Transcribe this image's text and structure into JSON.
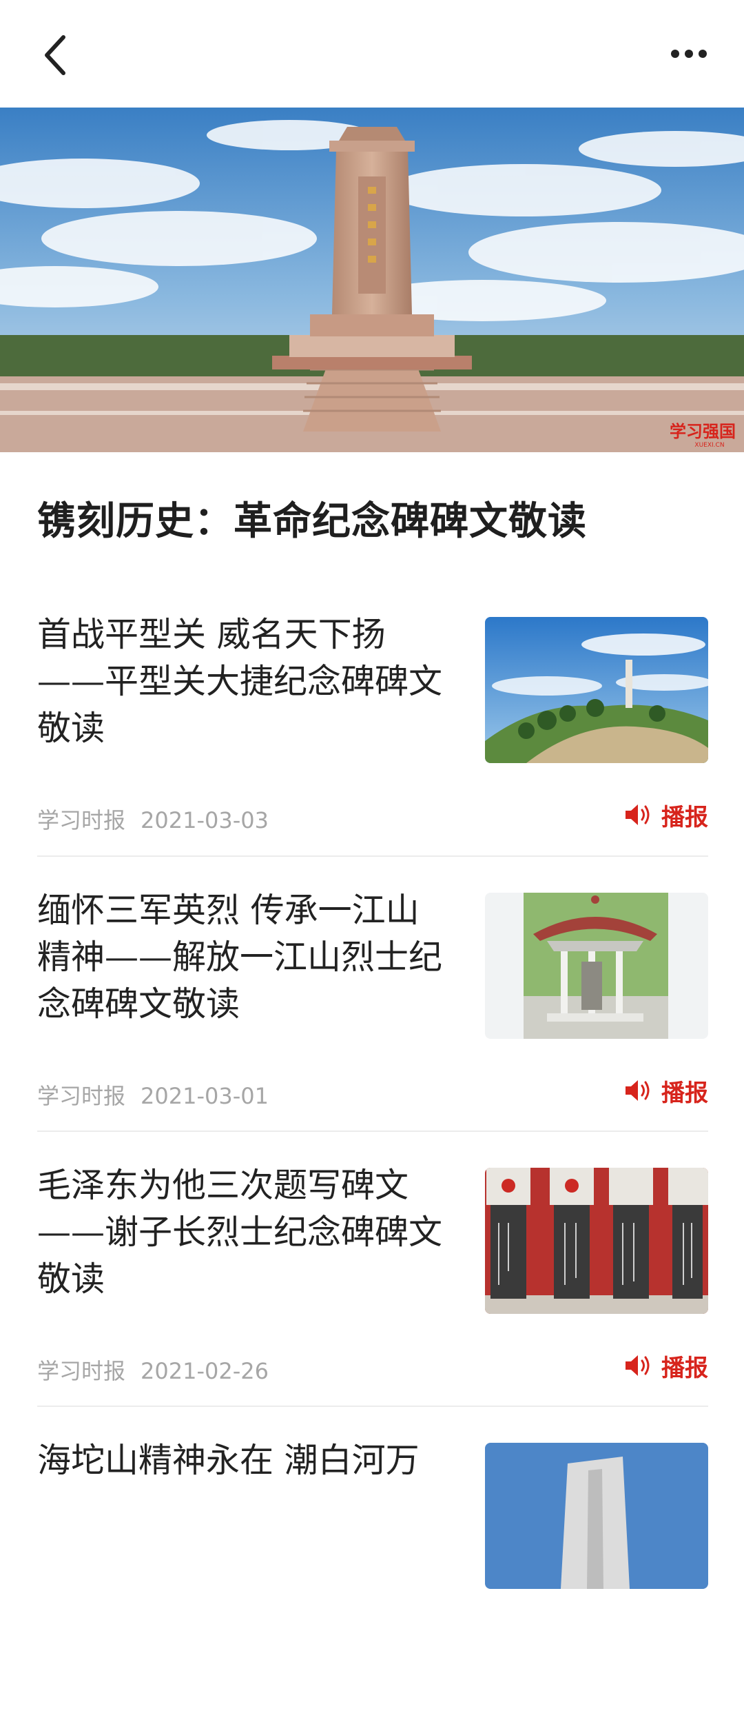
{
  "header": {
    "back_icon": "chevron-left-icon",
    "more_icon": "more-horizontal-icon"
  },
  "banner": {
    "watermark": "学习强国",
    "watermark_sub": "XUEXI.CN"
  },
  "page_title": "镌刻历史：革命纪念碑碑文敬读",
  "articles": [
    {
      "title": "首战平型关 威名天下扬——平型关大捷纪念碑碑文敬读",
      "source": "学习时报",
      "date": "2021-03-03",
      "play_label": "播报"
    },
    {
      "title": "缅怀三军英烈 传承一江山精神——解放一江山烈士纪念碑碑文敬读",
      "source": "学习时报",
      "date": "2021-03-01",
      "play_label": "播报"
    },
    {
      "title": "毛泽东为他三次题写碑文——谢子长烈士纪念碑碑文敬读",
      "source": "学习时报",
      "date": "2021-02-26",
      "play_label": "播报"
    },
    {
      "title": "海坨山精神永在 潮白河万",
      "source": "",
      "date": "",
      "play_label": ""
    }
  ],
  "colors": {
    "accent": "#d7241c",
    "meta_text": "#a6a6a6",
    "title_text": "#1f1f1f"
  }
}
